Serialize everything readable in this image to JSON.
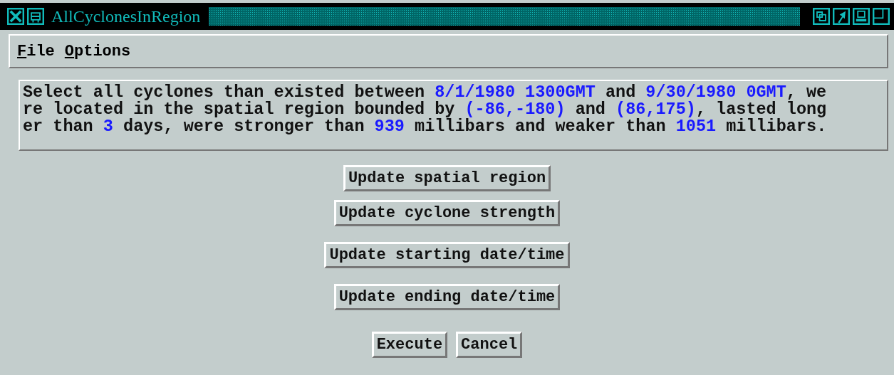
{
  "window": {
    "title": "AllCyclonesInRegion"
  },
  "menu": [
    {
      "mnemonic": "F",
      "rest": "ile"
    },
    {
      "mnemonic": "O",
      "rest": "ptions"
    }
  ],
  "query": {
    "lines": [
      [
        {
          "kind": "plain",
          "text": "Select all cyclones than existed between "
        },
        {
          "kind": "value",
          "text": "8/1/1980 1300GMT"
        },
        {
          "kind": "plain",
          "text": " and "
        },
        {
          "kind": "value",
          "text": "9/30/1980 0GMT"
        },
        {
          "kind": "plain",
          "text": ", we"
        }
      ],
      [
        {
          "kind": "plain",
          "text": "re located in the spatial region bounded by "
        },
        {
          "kind": "value",
          "text": "(-86,-180)"
        },
        {
          "kind": "plain",
          "text": " and "
        },
        {
          "kind": "value",
          "text": "(86,175)"
        },
        {
          "kind": "plain",
          "text": ", lasted long"
        }
      ],
      [
        {
          "kind": "plain",
          "text": "er than "
        },
        {
          "kind": "value",
          "text": "3"
        },
        {
          "kind": "plain",
          "text": " days, were stronger than "
        },
        {
          "kind": "value",
          "text": "939"
        },
        {
          "kind": "plain",
          "text": " millibars and weaker than "
        },
        {
          "kind": "value",
          "text": "1051"
        },
        {
          "kind": "plain",
          "text": " millibars."
        }
      ]
    ]
  },
  "update_buttons": [
    "Update spatial region",
    "Update cyclone strength",
    "Update starting date/time",
    "Update ending date/time"
  ],
  "actions": [
    "Execute",
    "Cancel"
  ]
}
